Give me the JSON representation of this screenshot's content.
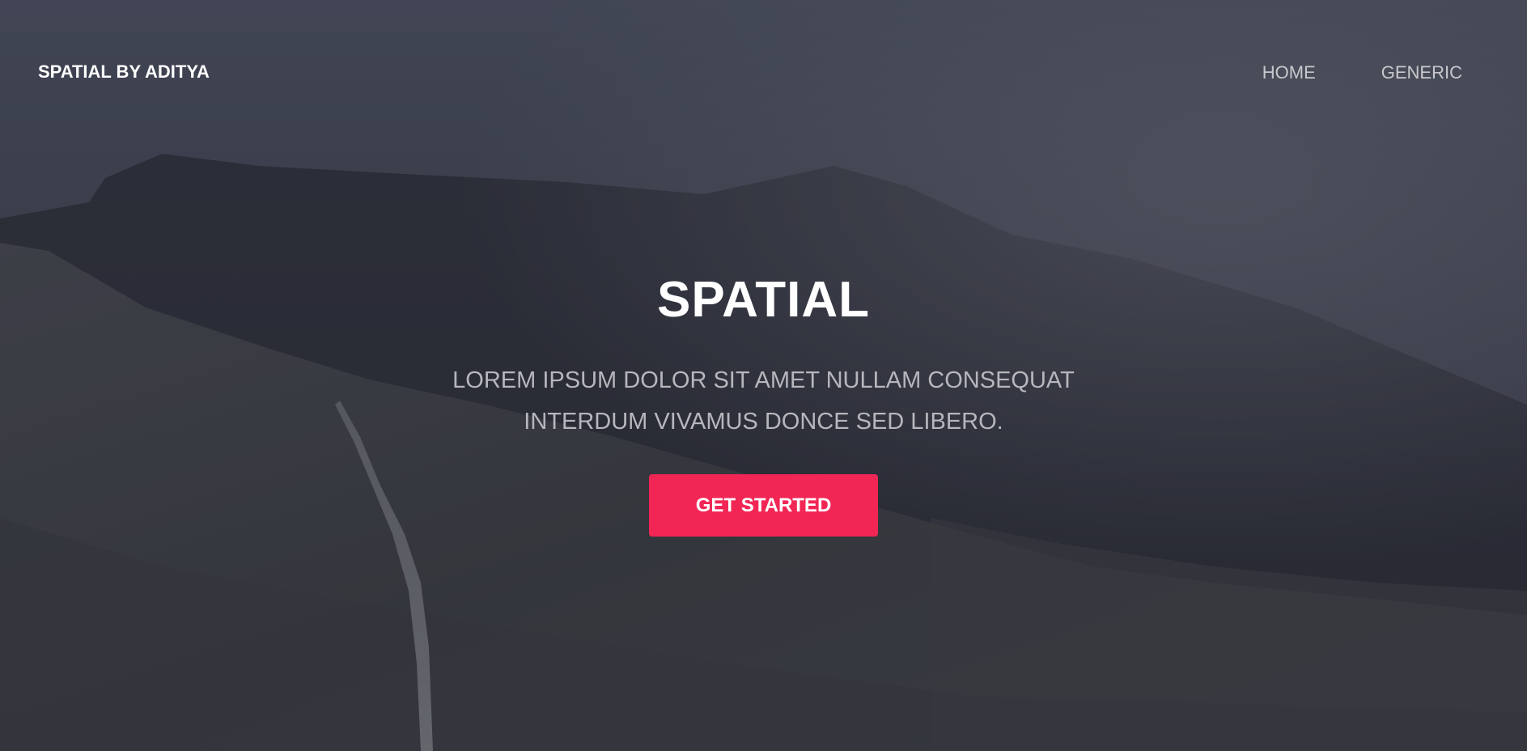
{
  "header": {
    "logo": "SPATIAL BY ADITYA",
    "nav": [
      {
        "label": "HOME"
      },
      {
        "label": "GENERIC"
      }
    ]
  },
  "banner": {
    "title": "SPATIAL",
    "subtitle_line1": "LOREM IPSUM DOLOR SIT AMET NULLAM CONSEQUAT",
    "subtitle_line2": "INTERDUM VIVAMUS DONCE SED LIBERO.",
    "cta_label": "GET STARTED"
  },
  "colors": {
    "accent": "#f22655",
    "overlay": "#2f313c",
    "nav_text": "#c8c8cc"
  }
}
